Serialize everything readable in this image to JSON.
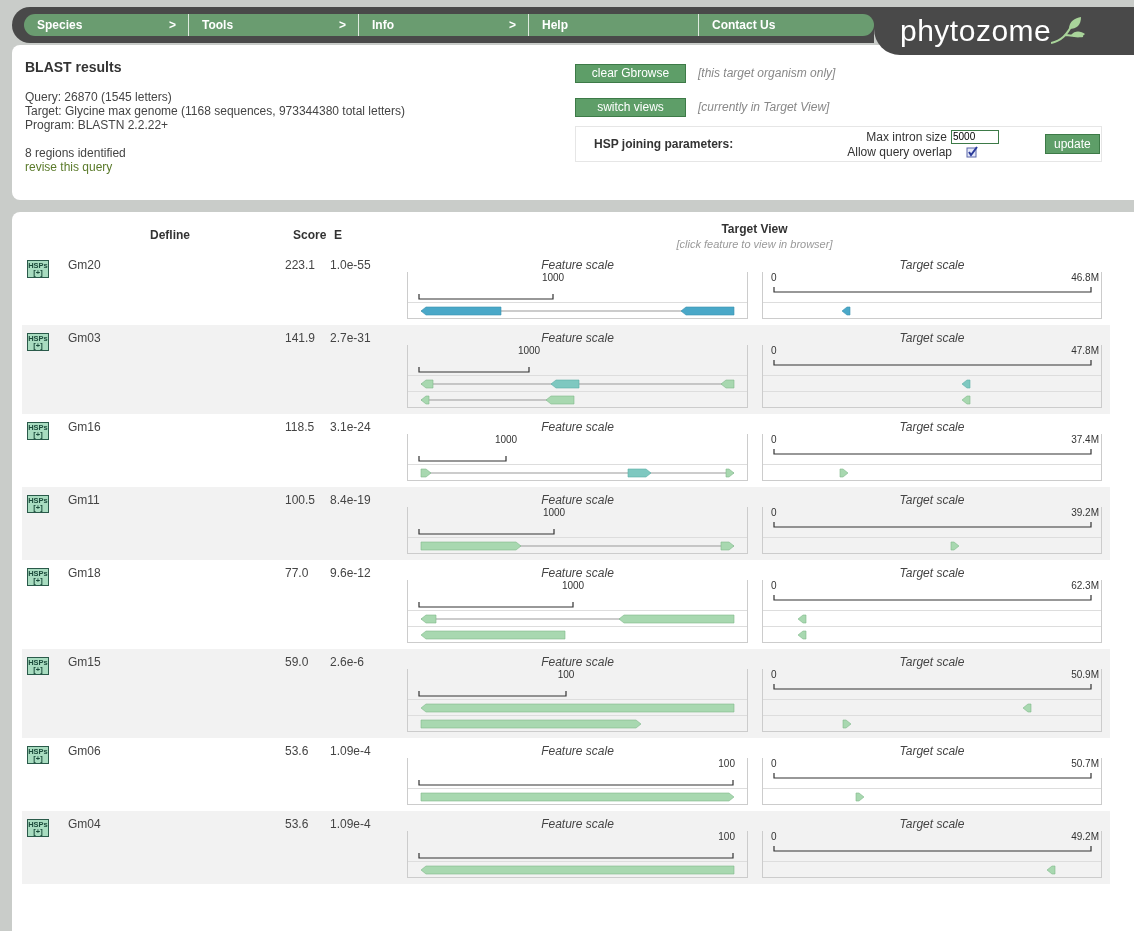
{
  "nav": {
    "items": [
      {
        "label": "Species",
        "arrow": ">"
      },
      {
        "label": "Tools",
        "arrow": ">"
      },
      {
        "label": "Info",
        "arrow": ">"
      },
      {
        "label": "Help"
      },
      {
        "label": "Contact Us"
      }
    ],
    "logo": "phytozome"
  },
  "summary": {
    "title": "BLAST results",
    "query": "Query: 26870 (1545 letters)",
    "target": "Target: Glycine max genome (1168 sequences, 973344380 total letters)",
    "program": "Program: BLASTN 2.2.22+",
    "regions": "8 regions identified",
    "revise_link": "revise this query"
  },
  "actions": [
    {
      "button": "clear Gbrowse",
      "note": "[this target organism only]"
    },
    {
      "button": "switch views",
      "note": "[currently in Target View]"
    }
  ],
  "hsp": {
    "label": "HSP joining parameters:",
    "intron_label": "Max intron size",
    "intron_value": "5000",
    "overlap_label": "Allow query overlap",
    "overlap_checked": true,
    "button": "update"
  },
  "results": {
    "columns": {
      "defline": "Defline",
      "score": "Score",
      "e": "E",
      "view_title": "Target View",
      "view_hint": "[click feature to view in browser]"
    },
    "rows": [
      {
        "icon_top": "HSPs",
        "icon_bottom": "[+]",
        "defline": "Gm20",
        "score": "223.1",
        "e": "1.0e-55",
        "feature_title": "Feature scale",
        "feature_scale": "1000",
        "target_title": "Target scale",
        "target_start": "0",
        "target_end": "46.8M"
      },
      {
        "icon_top": "HSPs",
        "icon_bottom": "[+]",
        "defline": "Gm03",
        "score": "141.9",
        "e": "2.7e-31",
        "feature_title": "Feature scale",
        "feature_scale": "1000",
        "target_title": "Target scale",
        "target_start": "0",
        "target_end": "47.8M"
      },
      {
        "icon_top": "HSPs",
        "icon_bottom": "[+]",
        "defline": "Gm16",
        "score": "118.5",
        "e": "3.1e-24",
        "feature_title": "Feature scale",
        "feature_scale": "1000",
        "target_title": "Target scale",
        "target_start": "0",
        "target_end": "37.4M"
      },
      {
        "icon_top": "HSPs",
        "icon_bottom": "[+]",
        "defline": "Gm11",
        "score": "100.5",
        "e": "8.4e-19",
        "feature_title": "Feature scale",
        "feature_scale": "1000",
        "target_title": "Target scale",
        "target_start": "0",
        "target_end": "39.2M"
      },
      {
        "icon_top": "HSPs",
        "icon_bottom": "[+]",
        "defline": "Gm18",
        "score": "77.0",
        "e": "9.6e-12",
        "feature_title": "Feature scale",
        "feature_scale": "1000",
        "target_title": "Target scale",
        "target_start": "0",
        "target_end": "62.3M"
      },
      {
        "icon_top": "HSPs",
        "icon_bottom": "[+]",
        "defline": "Gm15",
        "score": "59.0",
        "e": "2.6e-6",
        "feature_title": "Feature scale",
        "feature_scale": "100",
        "target_title": "Target scale",
        "target_start": "0",
        "target_end": "50.9M"
      },
      {
        "icon_top": "HSPs",
        "icon_bottom": "[+]",
        "defline": "Gm06",
        "score": "53.6",
        "e": "1.09e-4",
        "feature_title": "Feature scale",
        "feature_scale": "100",
        "target_title": "Target scale",
        "target_start": "0",
        "target_end": "50.7M"
      },
      {
        "icon_top": "HSPs",
        "icon_bottom": "[+]",
        "defline": "Gm04",
        "score": "53.6",
        "e": "1.09e-4",
        "feature_title": "Feature scale",
        "feature_scale": "100",
        "target_title": "Target scale",
        "target_start": "0",
        "target_end": "49.2M"
      }
    ]
  }
}
